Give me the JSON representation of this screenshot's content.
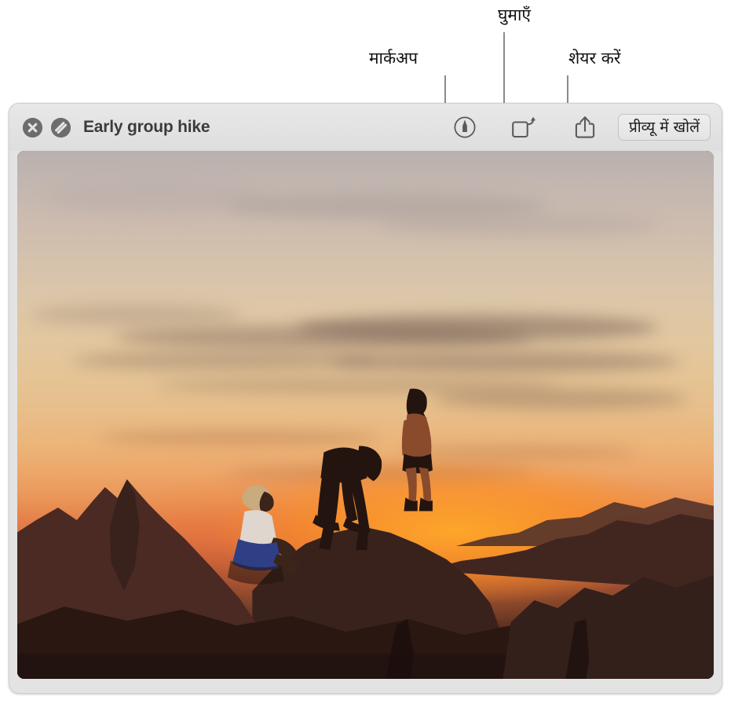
{
  "annotations": {
    "markup": {
      "label": "मार्कअप",
      "icon": "markup-pen-icon"
    },
    "rotate": {
      "label": "घुमाएँ",
      "icon": "rotate-icon"
    },
    "share": {
      "label": "शेयर करें",
      "icon": "share-icon"
    }
  },
  "window": {
    "title": "Early group hike",
    "close_icon": "close-x-icon",
    "block_icon": "markup-slash-icon",
    "chrome_color": "#e3e3e3",
    "title_color": "#3b3b3b"
  },
  "toolbar": {
    "markup_icon": "markup-pen-icon",
    "rotate_icon": "rotate-left-icon",
    "share_icon": "share-icon",
    "open_preview_label": "प्रीव्यू में खोलें"
  },
  "photo": {
    "name": "sunset-hikers-photo",
    "description": "Three hikers silhouetted on red sandstone rocks at sunset",
    "sky_top_color": "#b9b0ae",
    "sky_mid_color": "#e5c495",
    "horizon_glow_color": "#ffaa28",
    "rock_color": "#271511",
    "people_count": 3
  }
}
